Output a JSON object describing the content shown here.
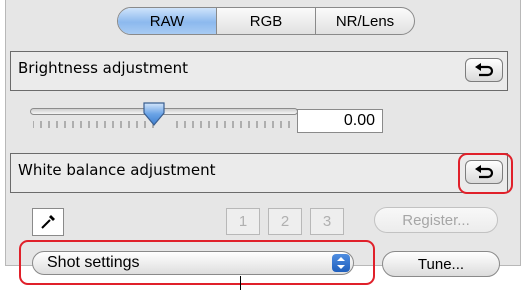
{
  "tabs": [
    {
      "label": "RAW",
      "active": true
    },
    {
      "label": "RGB",
      "active": false
    },
    {
      "label": "NR/Lens",
      "active": false
    }
  ],
  "brightness": {
    "title": "Brightness adjustment",
    "value": "0.00",
    "reset_icon": "undo-arrow-icon"
  },
  "white_balance": {
    "title": "White balance adjustment",
    "reset_icon": "undo-arrow-icon",
    "eyedropper_icon": "eyedropper-icon",
    "slots": [
      "1",
      "2",
      "3"
    ],
    "register_label": "Register...",
    "select_value": "Shot settings",
    "tune_label": "Tune..."
  },
  "colors": {
    "highlight": "#e0202a",
    "active_tab": "#8cb9ee"
  }
}
